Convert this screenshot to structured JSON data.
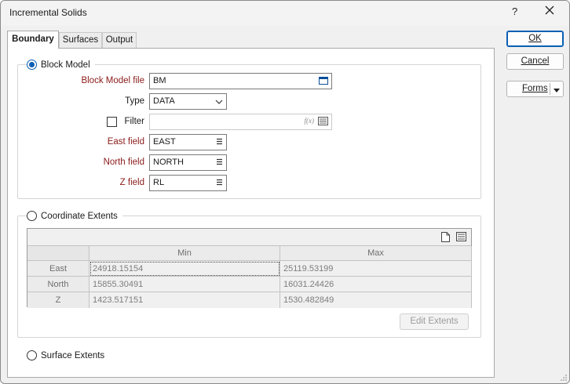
{
  "window": {
    "title": "Incremental Solids",
    "help_glyph": "?"
  },
  "tabs": [
    {
      "label": "Boundary",
      "active": true
    },
    {
      "label": "Surfaces",
      "active": false
    },
    {
      "label": "Output",
      "active": false
    }
  ],
  "block_model": {
    "radio_label": "Block Model",
    "selected": true,
    "file_label": "Block Model file",
    "file_value": "BM",
    "type_label": "Type",
    "type_value": "DATA",
    "filter_label": "Filter",
    "filter_checked": false,
    "filter_value": "",
    "filter_fx": "f(x)",
    "east_label": "East field",
    "east_value": "EAST",
    "north_label": "North field",
    "north_value": "NORTH",
    "z_label": "Z field",
    "z_value": "RL"
  },
  "coordinate_extents": {
    "radio_label": "Coordinate Extents",
    "selected": false,
    "columns": [
      "Min",
      "Max"
    ],
    "rows": [
      {
        "label": "East",
        "min": "24918.15154",
        "max": "25119.53199"
      },
      {
        "label": "North",
        "min": "15855.30491",
        "max": "16031.24426"
      },
      {
        "label": "Z",
        "min": "1423.517151",
        "max": "1530.482849"
      }
    ],
    "edit_button": "Edit Extents"
  },
  "surface_extents": {
    "radio_label": "Surface Extents",
    "selected": false
  },
  "buttons": {
    "ok": "OK",
    "cancel": "Cancel",
    "forms": "Forms"
  },
  "colors": {
    "accent": "#0a5fb4",
    "required_label": "#8b1a1a",
    "disabled_text": "#7d7d7d"
  }
}
